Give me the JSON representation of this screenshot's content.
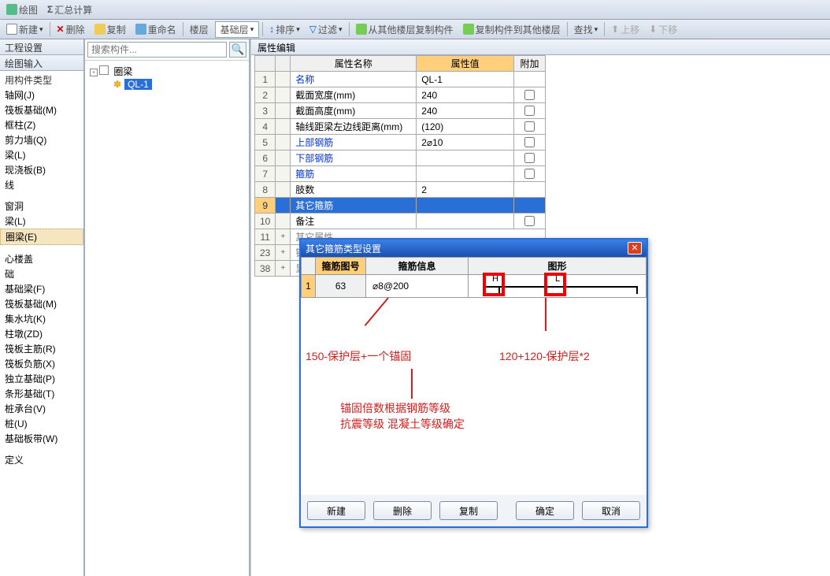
{
  "toolbar1": {
    "绘图": "绘图",
    "汇总": "汇总计算"
  },
  "toolbar2": {
    "new": "新建",
    "del": "删除",
    "copy": "复制",
    "rename": "重命名",
    "floor": "楼层",
    "floorSel": "基础层",
    "sort": "排序",
    "filter": "过滤",
    "copyFrom": "从其他楼层复制构件",
    "copyTo": "复制构件到其他楼层",
    "find": "查找",
    "up": "上移",
    "down": "下移"
  },
  "leftPanels": [
    "工程设置",
    "绘图输入"
  ],
  "leftSection1": {
    "hdr": "用构件类型",
    "items": [
      "轴网(J)",
      "筏板基础(M)",
      "框柱(Z)",
      "剪力墙(Q)",
      "梁(L)",
      "现浇板(B)"
    ]
  },
  "leftLine": "线",
  "leftSection2": {
    "hdr": "窗洞"
  },
  "leftSection3": {
    "items": [
      "梁(L)",
      "圈梁(E)"
    ]
  },
  "leftSection4": {
    "hdr": "心楼盖",
    "sub": "础",
    "items": [
      "基础梁(F)",
      "筏板基础(M)",
      "集水坑(K)",
      "柱墩(ZD)",
      "筏板主筋(R)",
      "筏板负筋(X)",
      "独立基础(P)",
      "条形基础(T)",
      "桩承台(V)",
      "桩(U)",
      "基础板带(W)"
    ]
  },
  "leftSection5": {
    "hdr": "定义"
  },
  "search_placeholder": "搜索构件...",
  "tree": {
    "root": "圈梁",
    "child": "QL-1"
  },
  "propTitle": "属性编辑",
  "propHeaders": {
    "name": "属性名称",
    "value": "属性值",
    "extra": "附加"
  },
  "props": [
    {
      "n": "1",
      "name": "名称",
      "val": "QL-1",
      "blue": true,
      "chk": false
    },
    {
      "n": "2",
      "name": "截面宽度(mm)",
      "val": "240",
      "blue": false,
      "chk": true
    },
    {
      "n": "3",
      "name": "截面高度(mm)",
      "val": "240",
      "blue": false,
      "chk": true
    },
    {
      "n": "4",
      "name": "轴线距梁左边线距离(mm)",
      "val": "(120)",
      "blue": false,
      "chk": true
    },
    {
      "n": "5",
      "name": "上部钢筋",
      "val": "2⌀10",
      "blue": true,
      "chk": true
    },
    {
      "n": "6",
      "name": "下部钢筋",
      "val": "",
      "blue": true,
      "chk": true
    },
    {
      "n": "7",
      "name": "箍筋",
      "val": "",
      "blue": true,
      "chk": true
    },
    {
      "n": "8",
      "name": "肢数",
      "val": "2",
      "blue": false,
      "chk": false
    },
    {
      "n": "9",
      "name": "其它箍筋",
      "val": "",
      "blue": true,
      "chk": false,
      "sel": true
    },
    {
      "n": "10",
      "name": "备注",
      "val": "",
      "blue": false,
      "chk": true
    }
  ],
  "propGroups": [
    {
      "n": "11",
      "name": "其它属性"
    },
    {
      "n": "23",
      "name": "锚固"
    },
    {
      "n": "38",
      "name": "显示"
    }
  ],
  "dialog": {
    "title": "其它箍筋类型设置",
    "headers": {
      "num": "箍筋图号",
      "info": "箍筋信息",
      "shape": "图形"
    },
    "row": {
      "n": "1",
      "fig": "63",
      "info": "⌀8@200",
      "H": "H",
      "L": "L"
    },
    "annot1": "150-保护层+一个锚固",
    "annot2": "120+120-保护层*2",
    "annot3": "锚固倍数根据钢筋等级",
    "annot4": "抗震等级 混凝土等级确定",
    "buttons": {
      "new": "新建",
      "del": "删除",
      "copy": "复制",
      "ok": "确定",
      "cancel": "取消"
    }
  }
}
